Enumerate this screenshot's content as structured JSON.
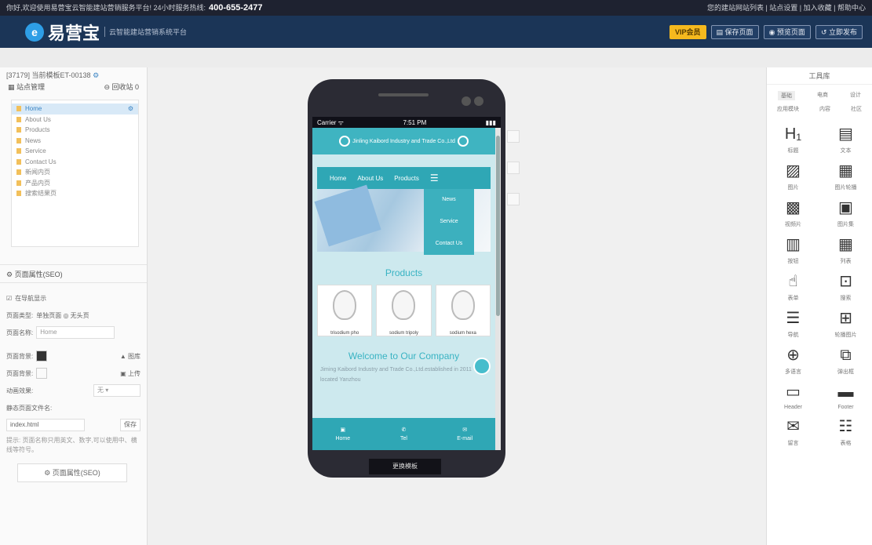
{
  "topbar": {
    "left": "你好,欢迎使用易营宝云智能建站营销服务平台! 24小时服务热线:",
    "phone": "400-655-2477",
    "right": "您的建站网站列表 | 站点设置 | 加入收藏 | 帮助中心"
  },
  "header": {
    "logo_glyph": "e",
    "brand": "易营宝",
    "tagline": "云智能建站营销系统平台",
    "vip": "VIP会员",
    "save": "保存页面",
    "preview": "预览页面",
    "publish": "立即发布"
  },
  "left": {
    "site": "[37179] 当前模板ET-00138",
    "manage": "站点管理",
    "recycle": "回收站 0",
    "pages": [
      "Home",
      "About Us",
      "Products",
      "News",
      "Service",
      "Contact Us",
      "新闻内页",
      "产品内页",
      "搜索结果页"
    ],
    "seo_title": "页面属性(SEO)",
    "nav_show": "在导航显示",
    "page_type_label": "页面类型:",
    "page_type_val": "单独页面 ◎ 无头页",
    "page_name_label": "页面名称:",
    "page_name_val": "Home",
    "bg_label": "页面背景:",
    "bg_opt": "图库",
    "bg2_label": "页面背景:",
    "bg2_opt": "上传",
    "anim_label": "动画效果:",
    "anim_val": "无",
    "static_label": "静态页面文件名:",
    "file_name": "index.html",
    "save_btn": "保存",
    "note": "提示: 页面名称只用英文、数字,可以使用中、横线等符号。",
    "seo_btn": "页面属性(SEO)"
  },
  "phone": {
    "carrier": "Carrier ᯤ",
    "time": "7:51 PM",
    "battery": "▮▮▮",
    "company": "Jinling Kaibord Industry and Trade Co.,Ltd",
    "nav": [
      "Home",
      "About Us",
      "Products"
    ],
    "dropdown": [
      "News",
      "Service",
      "Contact Us"
    ],
    "products_title": "Products",
    "products": [
      "trisodium pho",
      "sodium tripoly",
      "sodium hexa"
    ],
    "welcome": "Welcome to Our Company",
    "intro": "Jiming Kaibord Industry and Trade Co.,Ltd.established in 2011 located Yanzhou",
    "footer": [
      "Home",
      "Tel",
      "E-mail"
    ],
    "button": "更换模板"
  },
  "right": {
    "title": "工具库",
    "tabs": [
      "基础",
      "电商",
      "设计",
      "应用模块",
      "内容",
      "社区"
    ],
    "tools": [
      {
        "icon": "H₁",
        "label": "标题"
      },
      {
        "icon": "▤",
        "label": "文本"
      },
      {
        "icon": "▨",
        "label": "图片"
      },
      {
        "icon": "▦",
        "label": "图片轮播"
      },
      {
        "icon": "▩",
        "label": "视频片"
      },
      {
        "icon": "▣",
        "label": "图片集"
      },
      {
        "icon": "▥",
        "label": "按钮"
      },
      {
        "icon": "▦",
        "label": "列表"
      },
      {
        "icon": "☝",
        "label": "表单"
      },
      {
        "icon": "⊡",
        "label": "搜索"
      },
      {
        "icon": "☰",
        "label": "导航"
      },
      {
        "icon": "⊞",
        "label": "轮播图片"
      },
      {
        "icon": "⊕",
        "label": "多语言"
      },
      {
        "icon": "⧉",
        "label": "弹出框"
      },
      {
        "icon": "▭",
        "label": "Header"
      },
      {
        "icon": "▬",
        "label": "Footer"
      },
      {
        "icon": "✉",
        "label": "留言"
      },
      {
        "icon": "☷",
        "label": "表格"
      }
    ]
  }
}
